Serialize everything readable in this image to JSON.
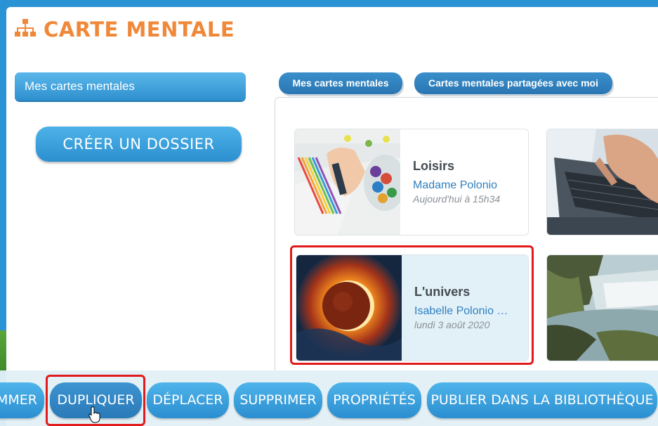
{
  "header": {
    "title": "CARTE MENTALE",
    "icon": "sitemap-icon",
    "accent": "#f0883a"
  },
  "sidebar": {
    "selected_folder": "Mes cartes mentales",
    "create_folder_label": "CRÉER UN DOSSIER"
  },
  "tabs": [
    {
      "label": "Mes cartes mentales"
    },
    {
      "label": "Cartes mentales partagées avec moi"
    }
  ],
  "cards": [
    {
      "title": "Loisirs",
      "author": "Madame Polonio",
      "date": "Aujourd'hui à 15h34",
      "thumb": "coloring-pencils-image"
    },
    {
      "title": "L'univers",
      "author": "Isabelle Polonio …",
      "date": "lundi 3 août 2020",
      "thumb": "eclipse-image",
      "selected": true
    },
    {
      "thumb": "laptop-typing-image"
    },
    {
      "thumb": "waterfall-image"
    }
  ],
  "actions": {
    "rename": "OMMER",
    "duplicate": "DUPLIQUER",
    "move": "DÉPLACER",
    "delete": "SUPPRIMER",
    "properties": "PROPRIÉTÉS",
    "publish": "PUBLIER DANS LA BIBLIOTHÈQUE"
  },
  "colors": {
    "button_blue": "#2b8ed0",
    "highlight_red": "#e11b1b",
    "selected_card_bg": "#e2f1f8"
  }
}
